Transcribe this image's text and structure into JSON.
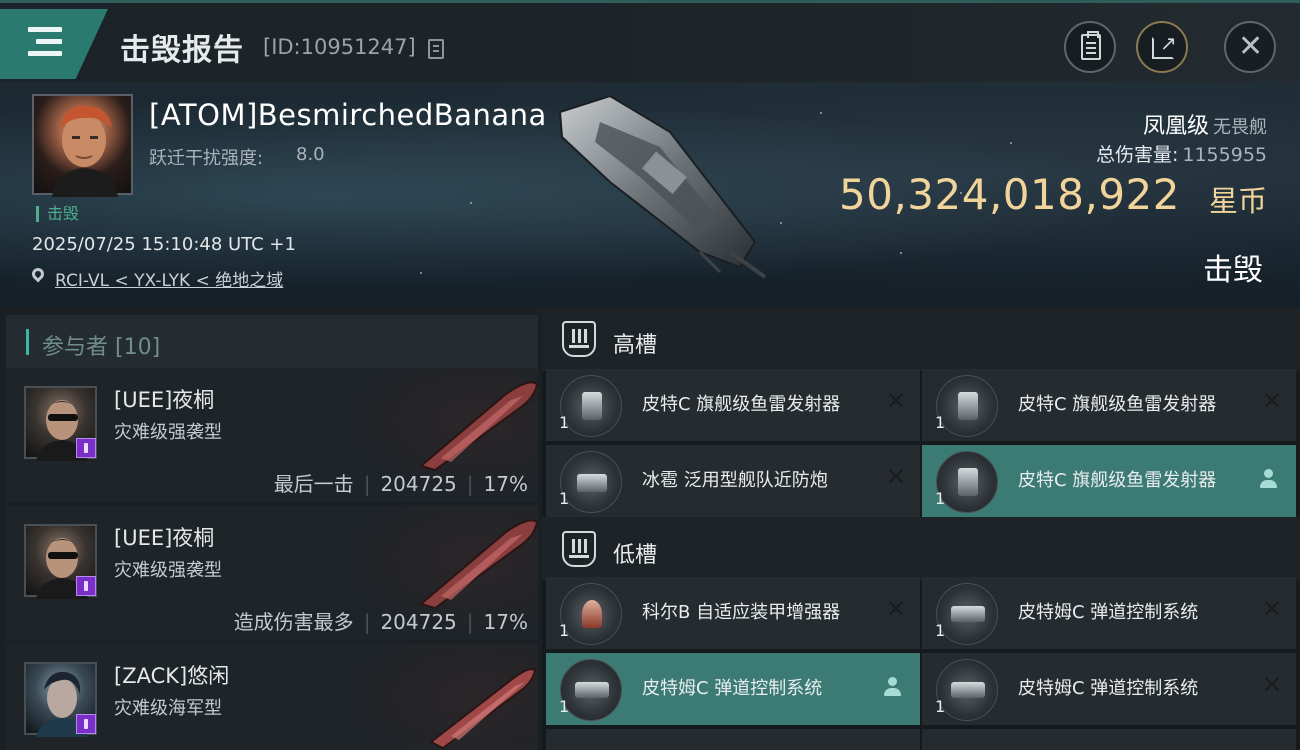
{
  "window": {
    "title": "击毁报告",
    "report_id": "[ID:10951247]"
  },
  "victim": {
    "name": "[ATOM]BesmirchedBanana",
    "warp_label": "跃迁干扰强度:",
    "warp_value": "8.0",
    "status": "击毁",
    "time": "2025/07/25 15:10:48 UTC +1",
    "location": "RCI-VL < YX-LYK < 绝地之域",
    "ship_class": "凤凰级",
    "ship_type": "无畏舰",
    "total_damage_label": "总伤害量:",
    "total_damage": "1155955",
    "isk_value": "50,324,018,922",
    "isk_unit": "星币",
    "kill_state": "击毁"
  },
  "participants": {
    "title": "参与者 [10]",
    "rows": [
      {
        "name": "[UEE]夜桐",
        "ship": "灾难级强袭型",
        "role": "最后一击",
        "damage": "204725",
        "percent": "17%"
      },
      {
        "name": "[UEE]夜桐",
        "ship": "灾难级强袭型",
        "role": "造成伤害最多",
        "damage": "204725",
        "percent": "17%"
      },
      {
        "name": "[ZACK]悠闲",
        "ship": "灾难级海军型",
        "role": "",
        "damage": "",
        "percent": ""
      }
    ]
  },
  "fitting": {
    "high_slot_label": "高槽",
    "low_slot_label": "低槽",
    "high_modules": [
      {
        "name": "皮特C 旗舰级鱼雷发射器",
        "qty": "1",
        "state": "destroyed"
      },
      {
        "name": "皮特C 旗舰级鱼雷发射器",
        "qty": "1",
        "state": "destroyed"
      },
      {
        "name": "冰雹 泛用型舰队近防炮",
        "qty": "1",
        "state": "destroyed"
      },
      {
        "name": "皮特C 旗舰级鱼雷发射器",
        "qty": "1",
        "state": "dropped"
      }
    ],
    "low_modules": [
      {
        "name": "科尔B 自适应装甲增强器",
        "qty": "1",
        "state": "destroyed"
      },
      {
        "name": "皮特姆C 弹道控制系统",
        "qty": "1",
        "state": "destroyed"
      },
      {
        "name": "皮特姆C 弹道控制系统",
        "qty": "1",
        "state": "dropped"
      },
      {
        "name": "皮特姆C 弹道控制系统",
        "qty": "1",
        "state": "destroyed"
      }
    ]
  },
  "colors": {
    "accent": "#3c7b73",
    "isk": "#f1d49a",
    "status_green": "#4fae8c"
  },
  "icons": [
    "menu-icon",
    "copy-icon",
    "clipboard-icon",
    "share-icon",
    "close-icon",
    "location-pin-icon",
    "high-slot-icon",
    "low-slot-icon",
    "remove-x-icon",
    "user-icon"
  ]
}
